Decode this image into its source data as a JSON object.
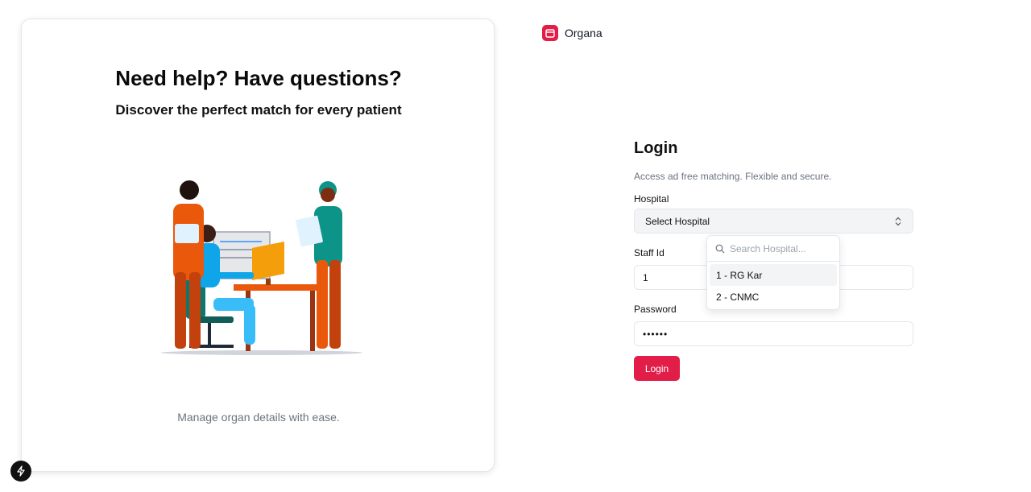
{
  "hero": {
    "title": "Need help? Have questions?",
    "subtitle": "Discover the perfect match for every patient",
    "footer": "Manage organ details with ease."
  },
  "brand": {
    "name": "Organa",
    "color": "#e11d48",
    "icon": "window-icon"
  },
  "login": {
    "title": "Login",
    "subtitle": "Access ad free matching. Flexible and secure.",
    "hospital_label": "Hospital",
    "hospital_select": "Select Hospital",
    "staff_label": "Staff Id",
    "staff_value": "1",
    "password_label": "Password",
    "password_value": "••••••",
    "button": "Login"
  },
  "dropdown": {
    "search_placeholder": "Search Hospital...",
    "options": [
      "1 - RG Kar",
      "2 - CNMC"
    ],
    "highlighted_index": 0
  },
  "colors": {
    "accent": "#e11d48"
  }
}
